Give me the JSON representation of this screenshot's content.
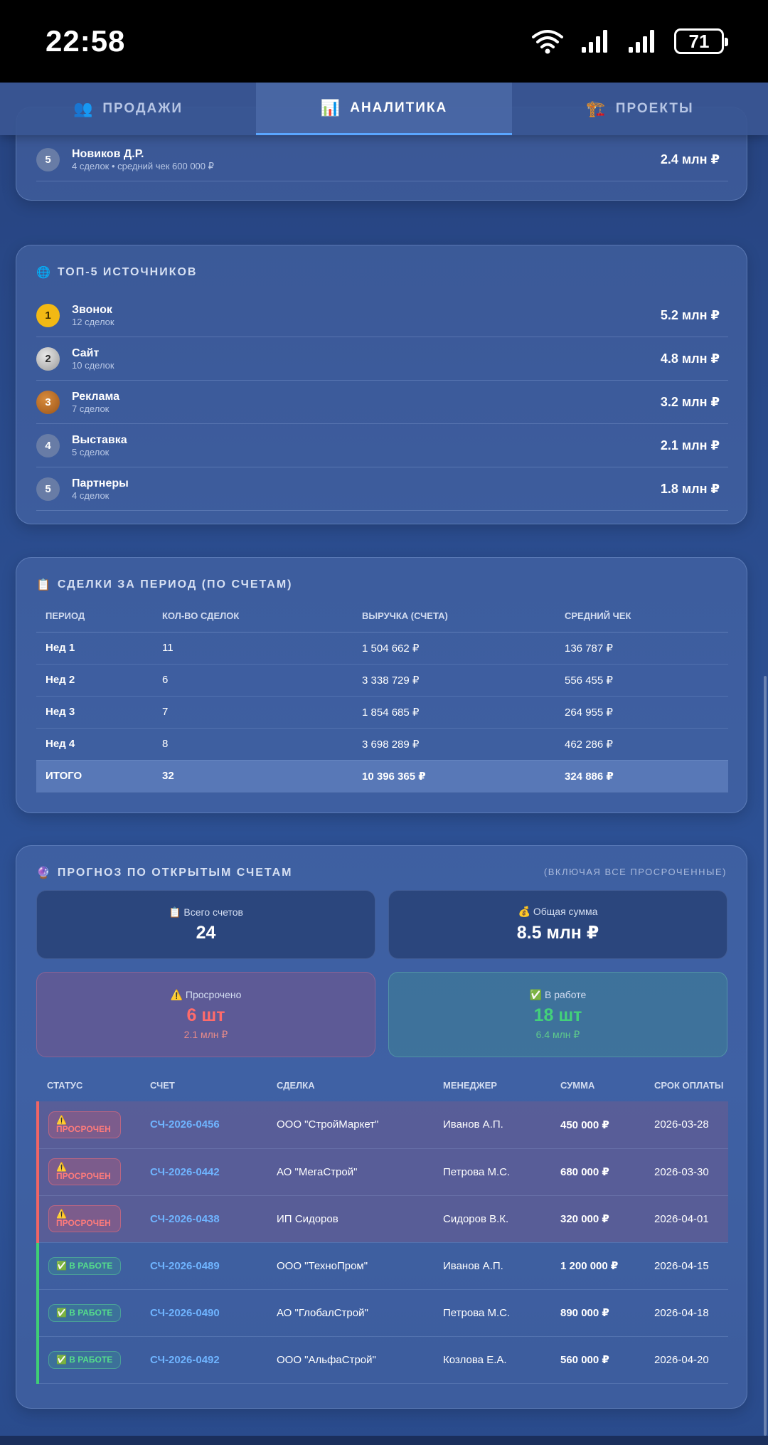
{
  "status_bar": {
    "time": "22:58",
    "battery": "71"
  },
  "tabs": [
    {
      "icon": "👥",
      "label": "ПРОДАЖИ"
    },
    {
      "icon": "📊",
      "label": "АНАЛИТИКА"
    },
    {
      "icon": "🏗️",
      "label": "ПРОЕКТЫ"
    }
  ],
  "managers_tail": {
    "rank": "5",
    "name": "Новиков Д.Р.",
    "sub": "4 сделок • средний чек 600 000 ₽",
    "amount": "2.4 млн ₽"
  },
  "sources": {
    "icon": "🌐",
    "title": "ТОП-5 ИСТОЧНИКОВ",
    "items": [
      {
        "rank": "1",
        "name": "Звонок",
        "sub": "12 сделок",
        "amount": "5.2 млн ₽"
      },
      {
        "rank": "2",
        "name": "Сайт",
        "sub": "10 сделок",
        "amount": "4.8 млн ₽"
      },
      {
        "rank": "3",
        "name": "Реклама",
        "sub": "7 сделок",
        "amount": "3.2 млн ₽"
      },
      {
        "rank": "4",
        "name": "Выставка",
        "sub": "5 сделок",
        "amount": "2.1 млн ₽"
      },
      {
        "rank": "5",
        "name": "Партнеры",
        "sub": "4 сделок",
        "amount": "1.8 млн ₽"
      }
    ]
  },
  "deals": {
    "icon": "📋",
    "title": "СДЕЛКИ ЗА ПЕРИОД (ПО СЧЕТАМ)",
    "headers": [
      "ПЕРИОД",
      "КОЛ-ВО СДЕЛОК",
      "ВЫРУЧКА (СЧЕТА)",
      "СРЕДНИЙ ЧЕК"
    ],
    "rows": [
      [
        "Нед 1",
        "11",
        "1 504 662 ₽",
        "136 787 ₽"
      ],
      [
        "Нед 2",
        "6",
        "3 338 729 ₽",
        "556 455 ₽"
      ],
      [
        "Нед 3",
        "7",
        "1 854 685 ₽",
        "264 955 ₽"
      ],
      [
        "Нед 4",
        "8",
        "3 698 289 ₽",
        "462 286 ₽"
      ]
    ],
    "total": [
      "ИТОГО",
      "32",
      "10 396 365 ₽",
      "324 886 ₽"
    ]
  },
  "forecast": {
    "icon": "🔮",
    "title": "ПРОГНОЗ ПО ОТКРЫТЫМ СЧЕТАМ",
    "note": "(ВКЛЮЧАЯ ВСЕ ПРОСРОЧЕННЫЕ)",
    "total_invoices": {
      "icon": "📋",
      "label": "Всего счетов",
      "value": "24"
    },
    "total_sum": {
      "icon": "💰",
      "label": "Общая сумма",
      "value": "8.5 млн ₽"
    },
    "overdue": {
      "icon": "⚠️",
      "label": "Просрочено",
      "value": "6 шт",
      "sub": "2.1 млн ₽"
    },
    "in_work": {
      "icon": "✅",
      "label": "В работе",
      "value": "18 шт",
      "sub": "6.4 млн ₽"
    },
    "headers": [
      "СТАТУС",
      "СЧЕТ",
      "СДЕЛКА",
      "МЕНЕДЖЕР",
      "СУММА",
      "СРОК ОПЛАТЫ"
    ],
    "invoices": [
      {
        "status_icon": "⚠️",
        "status": "ПРОСРОЧЕН",
        "number": "СЧ-2026-0456",
        "deal": "ООО \"СтройМаркет\"",
        "manager": "Иванов А.П.",
        "sum": "450 000 ₽",
        "due": "2026-03-28"
      },
      {
        "status_icon": "⚠️",
        "status": "ПРОСРОЧЕН",
        "number": "СЧ-2026-0442",
        "deal": "АО \"МегаСтрой\"",
        "manager": "Петрова М.С.",
        "sum": "680 000 ₽",
        "due": "2026-03-30"
      },
      {
        "status_icon": "⚠️",
        "status": "ПРОСРОЧЕН",
        "number": "СЧ-2026-0438",
        "deal": "ИП Сидоров",
        "manager": "Сидоров В.К.",
        "sum": "320 000 ₽",
        "due": "2026-04-01"
      },
      {
        "status_icon": "✅",
        "status": "В РАБОТЕ",
        "number": "СЧ-2026-0489",
        "deal": "ООО \"ТехноПром\"",
        "manager": "Иванов А.П.",
        "sum": "1 200 000 ₽",
        "due": "2026-04-15"
      },
      {
        "status_icon": "✅",
        "status": "В РАБОТЕ",
        "number": "СЧ-2026-0490",
        "deal": "АО \"ГлобалСтрой\"",
        "manager": "Петрова М.С.",
        "sum": "890 000 ₽",
        "due": "2026-04-18"
      },
      {
        "status_icon": "✅",
        "status": "В РАБОТЕ",
        "number": "СЧ-2026-0492",
        "deal": "ООО \"АльфаСтрой\"",
        "manager": "Козлова Е.А.",
        "sum": "560 000 ₽",
        "due": "2026-04-20"
      }
    ]
  }
}
